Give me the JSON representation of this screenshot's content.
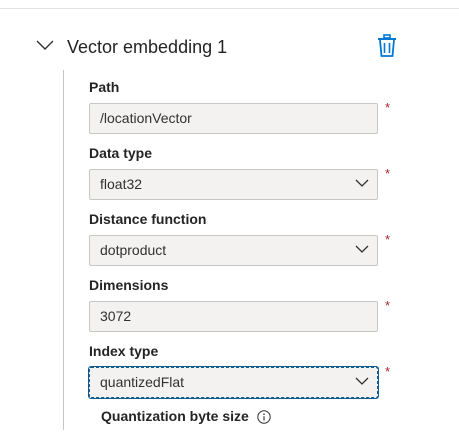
{
  "section": {
    "title": "Vector embedding 1"
  },
  "fields": {
    "path": {
      "label": "Path",
      "value": "/locationVector",
      "required": "*"
    },
    "data_type": {
      "label": "Data type",
      "value": "float32",
      "required": "*"
    },
    "distance_function": {
      "label": "Distance function",
      "value": "dotproduct",
      "required": "*"
    },
    "dimensions": {
      "label": "Dimensions",
      "value": "3072",
      "required": "*"
    },
    "index_type": {
      "label": "Index type",
      "value": "quantizedFlat",
      "required": "*"
    },
    "quantization": {
      "label": "Quantization byte size"
    }
  },
  "icons": {
    "collapse": "chevron-down-icon",
    "delete": "trash-icon",
    "dropdown": "chevron-down-icon",
    "info": "info-icon"
  },
  "colors": {
    "accent": "#0078d4",
    "required": "#a4262c",
    "field_bg": "#f3f2f1",
    "focus_border": "#0f5a8f"
  }
}
